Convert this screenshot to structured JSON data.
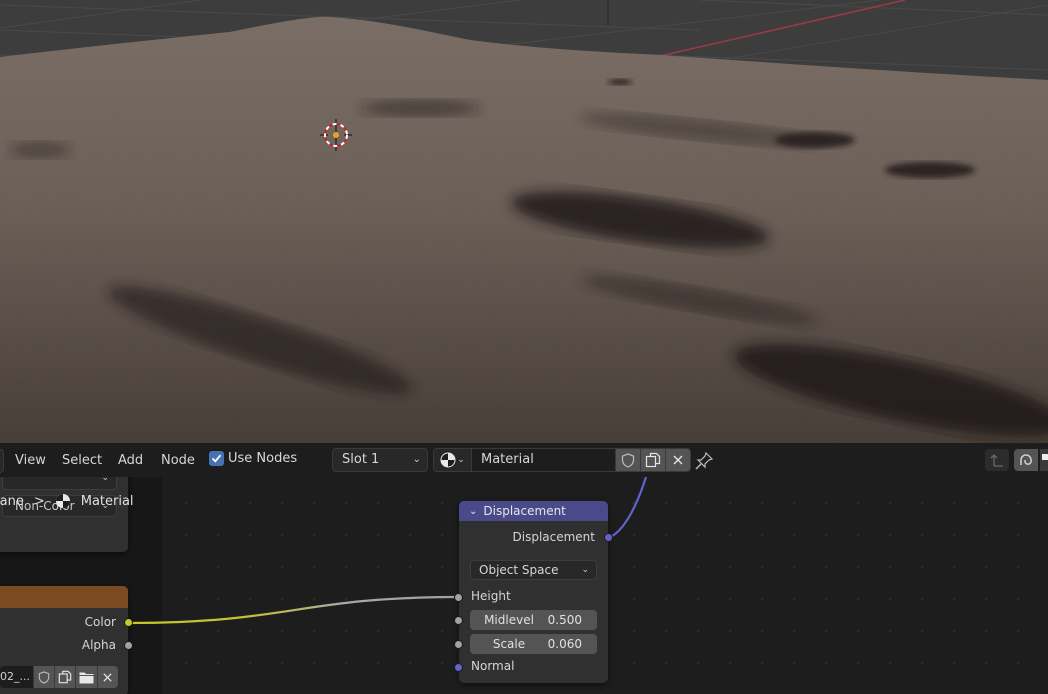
{
  "node_editor_header": {
    "menus": [
      "View",
      "Select",
      "Add",
      "Node"
    ],
    "use_nodes": {
      "label": "Use Nodes",
      "checked": true
    },
    "slot": {
      "value": "Slot 1"
    },
    "material": {
      "name": "Material",
      "browse_icon": "material-sphere-icon"
    },
    "material_buttons": [
      "fake-user-shield-icon",
      "duplicate-icon",
      "unlink-x-icon"
    ],
    "pin_icon": "pin-icon",
    "right_buttons": [
      "parent-node-tree-icon",
      "snap-magnet-icon"
    ]
  },
  "breadcrumbs": {
    "items": [
      "lane",
      "Material"
    ],
    "separator": ">",
    "material_icon": "material-sphere-icon"
  },
  "nodes": {
    "partial_top": {
      "color_space": "Non-Color"
    },
    "image_texture": {
      "header_color": "#7b4a1f",
      "outputs": [
        {
          "label": "Color",
          "socket_color": "#c7c729"
        },
        {
          "label": "Alpha",
          "socket_color": "#a1a1a1"
        }
      ],
      "image_name": "02_...",
      "buttons": [
        "fake-user-shield-icon",
        "duplicate-icon",
        "open-folder-icon",
        "unlink-x-icon"
      ]
    },
    "displacement": {
      "title": "Displacement",
      "header_color": "#4a4a8a",
      "output": {
        "label": "Displacement",
        "socket_color": "#6363c7"
      },
      "space": "Object Space",
      "inputs": {
        "height": {
          "label": "Height",
          "socket_color": "#a1a1a1"
        },
        "midlevel": {
          "label": "Midlevel",
          "value": "0.500",
          "socket_color": "#a1a1a1"
        },
        "scale": {
          "label": "Scale",
          "value": "0.060",
          "socket_color": "#a1a1a1"
        },
        "normal": {
          "label": "Normal",
          "socket_color": "#6363c7"
        }
      }
    }
  },
  "colors": {
    "accent_checkbox": "#4772b3",
    "link_color_to_gray": [
      "#c7c729",
      "#a1a1a1"
    ],
    "link_vector": "#6363c7"
  }
}
